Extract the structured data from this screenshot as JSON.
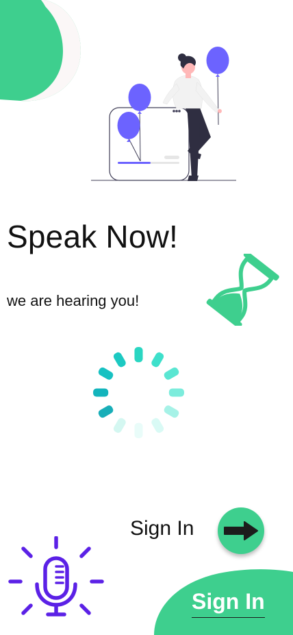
{
  "page": {
    "title": "Speak Now!",
    "subtitle": "we are hearing you!"
  },
  "actions": {
    "signin_label": "Sign In",
    "signin_link_label": "Sign In"
  },
  "colors": {
    "accent_green": "#3ecf8e",
    "teal_spinner": "#25d3c0",
    "purple": "#6c63ff",
    "mic_purple": "#5b21e6",
    "text": "#111111"
  },
  "icons": {
    "hero": "woman-with-balloons-illustration",
    "hourglass": "hourglass-icon",
    "spinner": "loading-spinner-icon",
    "arrow": "arrow-right-icon",
    "mic": "microphone-icon"
  }
}
